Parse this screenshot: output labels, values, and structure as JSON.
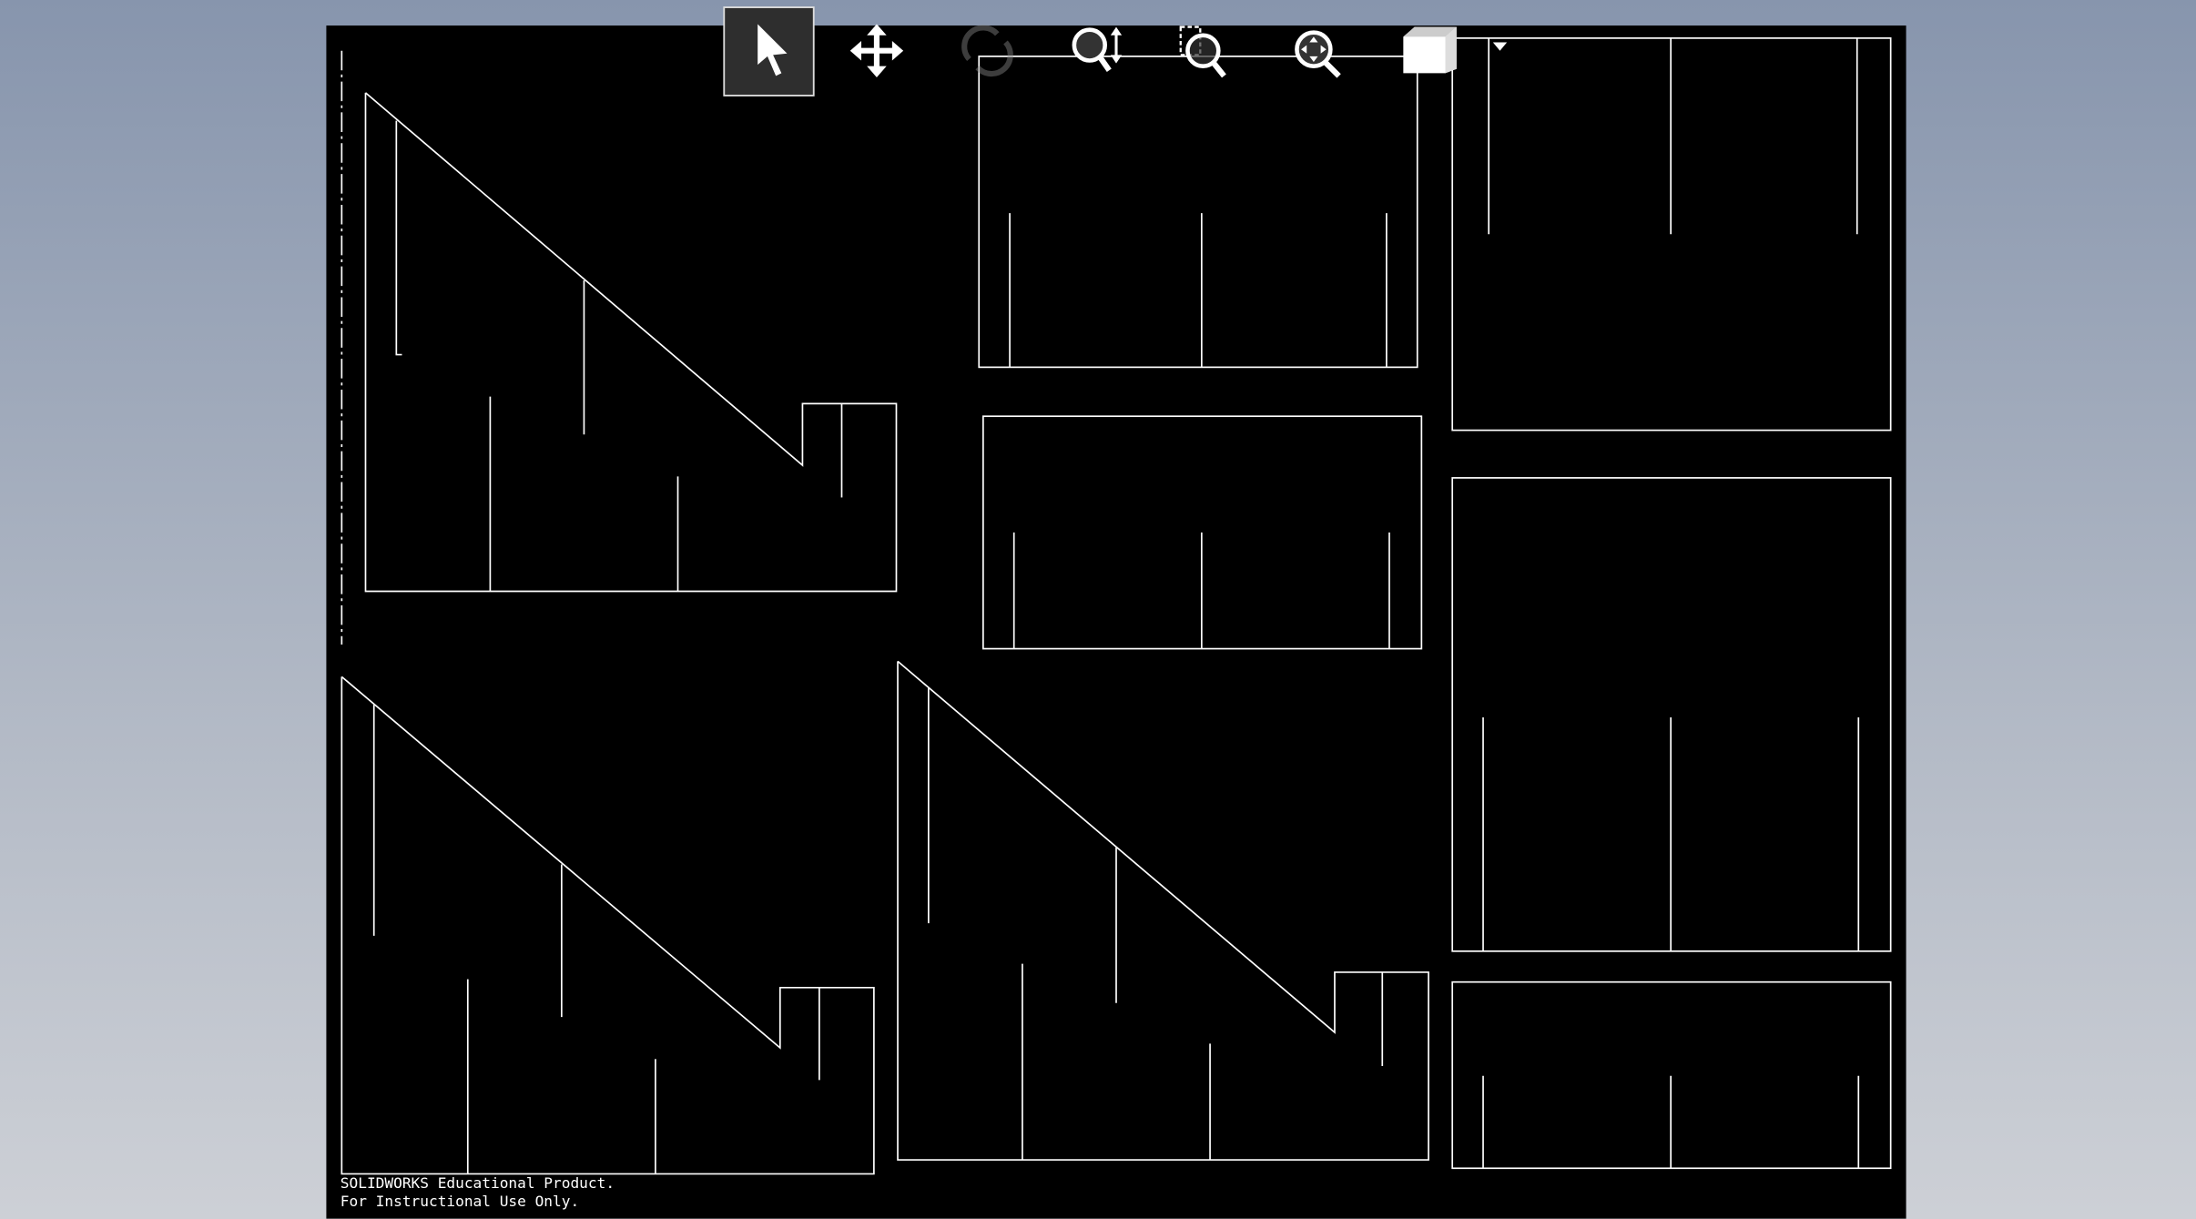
{
  "watermark": {
    "line1": "SOLIDWORKS Educational Product.",
    "line2": "For Instructional Use Only."
  },
  "toolbar": {
    "tools": [
      {
        "icon": "select-arrow-icon",
        "active": true
      },
      {
        "icon": "pan-icon"
      },
      {
        "icon": "rotate-icon",
        "disabled": true
      },
      {
        "icon": "zoom-in-out-icon"
      },
      {
        "icon": "zoom-to-area-icon"
      },
      {
        "icon": "zoom-to-fit-icon"
      },
      {
        "icon": "view-orientation-icon"
      },
      {
        "icon": "dropdown-arrow-icon"
      }
    ]
  },
  "colors": {
    "canvas": "#000000",
    "lines": "#ffffff",
    "background_top": "#8795ad",
    "background_bottom": "#cdd0d6"
  }
}
